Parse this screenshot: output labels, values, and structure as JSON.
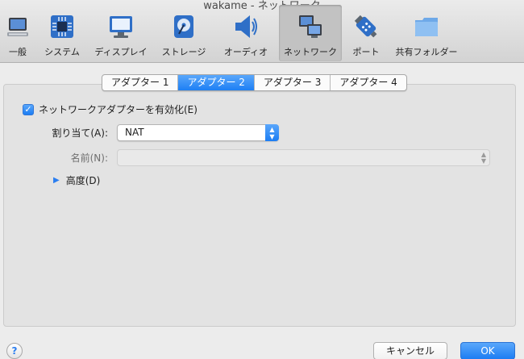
{
  "window": {
    "title": "wakame - ネットワーク"
  },
  "toolbar": {
    "items": [
      {
        "label": "一般",
        "icon": "general-icon"
      },
      {
        "label": "システム",
        "icon": "system-chip-icon"
      },
      {
        "label": "ディスプレイ",
        "icon": "display-monitor-icon"
      },
      {
        "label": "ストレージ",
        "icon": "storage-disk-icon"
      },
      {
        "label": "オーディオ",
        "icon": "audio-speaker-icon"
      },
      {
        "label": "ネットワーク",
        "icon": "network-icon"
      },
      {
        "label": "ポート",
        "icon": "port-connector-icon"
      },
      {
        "label": "共有フォルダー",
        "icon": "shared-folder-icon"
      }
    ],
    "active": "ネットワーク"
  },
  "tabs": [
    {
      "label": "アダプター 1"
    },
    {
      "label": "アダプター 2"
    },
    {
      "label": "アダプター 3"
    },
    {
      "label": "アダプター 4"
    }
  ],
  "active_tab": "アダプター 2",
  "form": {
    "enable_label": "ネットワークアダプターを有効化(E)",
    "enable_checked": true,
    "attached_label": "割り当て(A):",
    "attached_value": "NAT",
    "name_label": "名前(N):",
    "name_value": "",
    "advanced_label": "高度(D)"
  },
  "buttons": {
    "help": "?",
    "cancel": "キャンセル",
    "ok": "OK"
  },
  "colors": {
    "accent": "#1d7ff4"
  }
}
